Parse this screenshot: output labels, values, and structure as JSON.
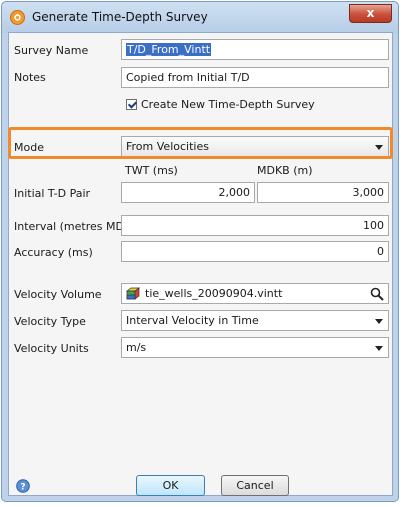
{
  "window": {
    "title": "Generate Time-Depth Survey",
    "close_label": "x"
  },
  "form": {
    "survey_name_label": "Survey Name",
    "survey_name_value": "T/D_From_Vintt",
    "notes_label": "Notes",
    "notes_value": "Copied from Initial T/D",
    "create_checkbox_label": "Create New Time-Depth Survey",
    "create_checkbox_checked": true,
    "mode_label": "Mode",
    "mode_value": "From Velocities",
    "twt_header": "TWT (ms)",
    "mdkb_header": "MDKB (m)",
    "initial_pair_label": "Initial T-D Pair",
    "initial_twt_value": "2,000",
    "initial_mdkb_value": "3,000",
    "interval_label": "Interval (metres MD)",
    "interval_value": "100",
    "accuracy_label": "Accuracy (ms)",
    "accuracy_value": "0",
    "velocity_volume_label": "Velocity Volume",
    "velocity_volume_value": "tie_wells_20090904.vintt",
    "velocity_type_label": "Velocity Type",
    "velocity_type_value": "Interval Velocity in Time",
    "velocity_units_label": "Velocity Units",
    "velocity_units_value": "m/s"
  },
  "buttons": {
    "ok_label": "OK",
    "cancel_label": "Cancel"
  },
  "colors": {
    "highlight_frame": "#f08a2a",
    "selection": "#3b6ec5",
    "window_frame": "#bed3ea"
  }
}
